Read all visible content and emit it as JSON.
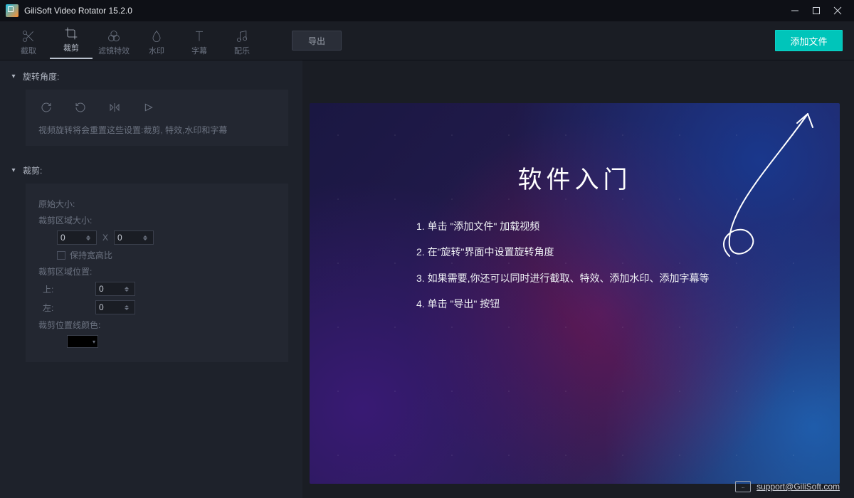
{
  "window": {
    "title": "GiliSoft Video Rotator 15.2.0"
  },
  "toolbar": {
    "tools": {
      "cut": "截取",
      "crop": "裁剪",
      "filter": "滤镜特效",
      "watermark": "水印",
      "subtitle": "字幕",
      "music": "配乐"
    },
    "export_label": "导出",
    "add_file_label": "添加文件"
  },
  "sidebar": {
    "rotate_section": "旋转角度:",
    "rotate_hint": "视频旋转将会重置这些设置:裁剪, 特效,水印和字幕",
    "crop_section": "裁剪:",
    "original_size": "原始大小:",
    "crop_area_size": "裁剪区域大小:",
    "size_w": "0",
    "size_sep": "X",
    "size_h": "0",
    "keep_aspect": "保持宽高比",
    "crop_area_pos": "裁剪区域位置:",
    "pos_top": "上:",
    "pos_top_val": "0",
    "pos_left": "左:",
    "pos_left_val": "0",
    "line_color": "裁剪位置线颜色:"
  },
  "preview": {
    "heading": "软件入门",
    "steps": {
      "s1": "1. 单击 \"添加文件\" 加载视频",
      "s2": "2. 在\"旋转\"界面中设置旋转角度",
      "s3": "3. 如果需要,你还可以同时进行截取、特效、添加水印、添加字幕等",
      "s4": "4. 单击 \"导出\" 按钮"
    }
  },
  "footer": {
    "email": "support@GiliSoft.com"
  }
}
